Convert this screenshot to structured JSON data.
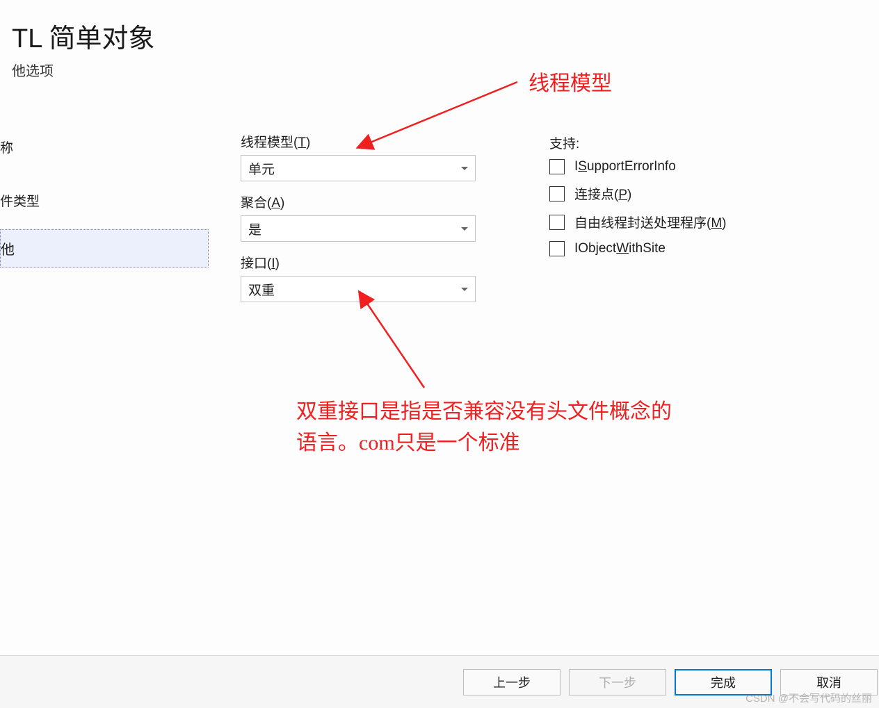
{
  "header": {
    "title": "TL 简单对象",
    "subtitle": "他选项"
  },
  "sidebar": {
    "items": [
      {
        "label": "称"
      },
      {
        "label": "件类型"
      },
      {
        "label": "他",
        "selected": true
      }
    ]
  },
  "form": {
    "threading": {
      "label_prefix": "线程模型(",
      "hotkey": "T",
      "label_suffix": ")",
      "value": "单元"
    },
    "aggregation": {
      "label_prefix": "聚合(",
      "hotkey": "A",
      "label_suffix": ")",
      "value": "是"
    },
    "interface": {
      "label_prefix": "接口(",
      "hotkey": "I",
      "label_suffix": ")",
      "value": "双重"
    }
  },
  "support": {
    "title": "支持:",
    "options": [
      {
        "prefix": "I",
        "hotkey": "S",
        "suffix": "upportErrorInfo"
      },
      {
        "prefix": "连接点(",
        "hotkey": "P",
        "suffix": ")"
      },
      {
        "prefix": "自由线程封送处理程序(",
        "hotkey": "M",
        "suffix": ")"
      },
      {
        "prefix": "IObject",
        "hotkey": "W",
        "suffix": "ithSite"
      }
    ]
  },
  "annotations": {
    "a1": "线程模型",
    "a2": "双重接口是指是否兼容没有头文件概念的语言。com只是一个标准"
  },
  "footer": {
    "back": "上一步",
    "next": "下一步",
    "finish": "完成",
    "cancel": "取消"
  },
  "watermark": "CSDN @不会写代码的丝丽"
}
